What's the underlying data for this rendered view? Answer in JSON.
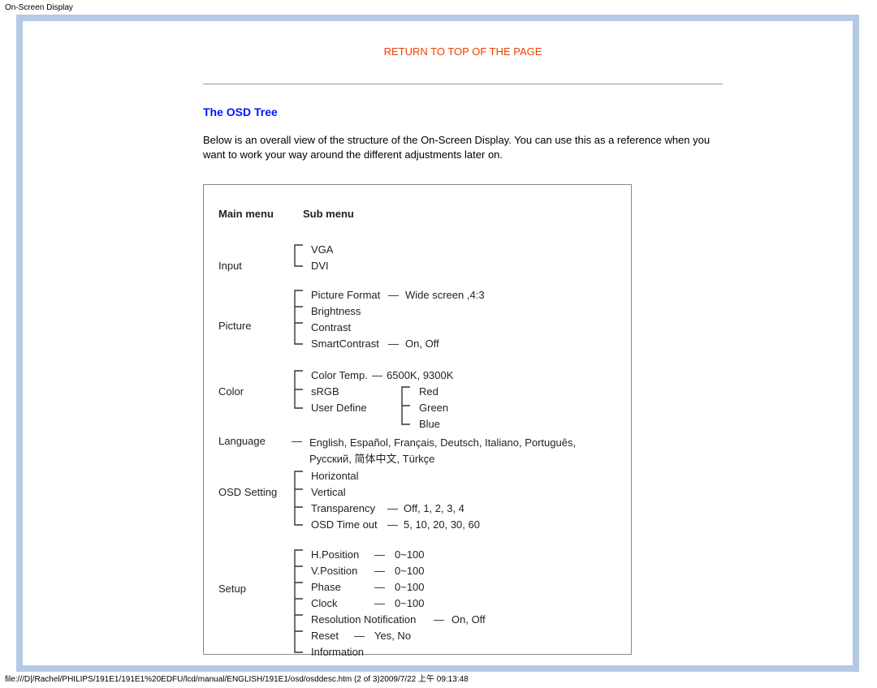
{
  "header": {
    "title": "On-Screen Display"
  },
  "footer": {
    "path": "file:///D|/Rachel/PHILIPS/191E1/191E1%20EDFU/lcd/manual/ENGLISH/191E1/osd/osddesc.htm (2 of 3)2009/7/22 上午 09:13:48"
  },
  "links": {
    "return_top": "RETURN TO TOP OF THE PAGE"
  },
  "section": {
    "title": "The OSD Tree",
    "intro": "Below is an overall view of the structure of the On-Screen Display. You can use this as a reference when you want to work your way around the different adjustments later on."
  },
  "tree": {
    "head_main": "Main menu",
    "head_sub": "Sub menu",
    "input": {
      "label": "Input",
      "vga": "VGA",
      "dvi": "DVI"
    },
    "picture": {
      "label": "Picture",
      "format": "Picture Format",
      "format_values": "Wide screen ,4:3",
      "brightness": "Brightness",
      "contrast": "Contrast",
      "smart": "SmartContrast",
      "smart_values": "On, Off"
    },
    "color": {
      "label": "Color",
      "temp": "Color Temp.",
      "temp_values": "6500K, 9300K",
      "srgb": "sRGB",
      "userdef": "User Define",
      "red": "Red",
      "green": "Green",
      "blue": "Blue"
    },
    "language": {
      "label": "Language",
      "values": "English, Español, Français, Deutsch, Italiano, Português, Русский, 简体中文, Türkçe"
    },
    "osd": {
      "label": "OSD Setting",
      "horizontal": "Horizontal",
      "vertical": "Vertical",
      "transparency": "Transparency",
      "transparency_values": "Off, 1, 2, 3, 4",
      "timeout": "OSD Time out",
      "timeout_values": "5, 10, 20, 30, 60"
    },
    "setup": {
      "label": "Setup",
      "hpos": "H.Position",
      "hpos_v": "0~100",
      "vpos": "V.Position",
      "vpos_v": "0~100",
      "phase": "Phase",
      "phase_v": "0~100",
      "clock": "Clock",
      "clock_v": "0~100",
      "resn": "Resolution Notification",
      "resn_v": "On, Off",
      "reset": "Reset",
      "reset_v": "Yes, No",
      "info": "Information"
    },
    "dash": "—"
  }
}
